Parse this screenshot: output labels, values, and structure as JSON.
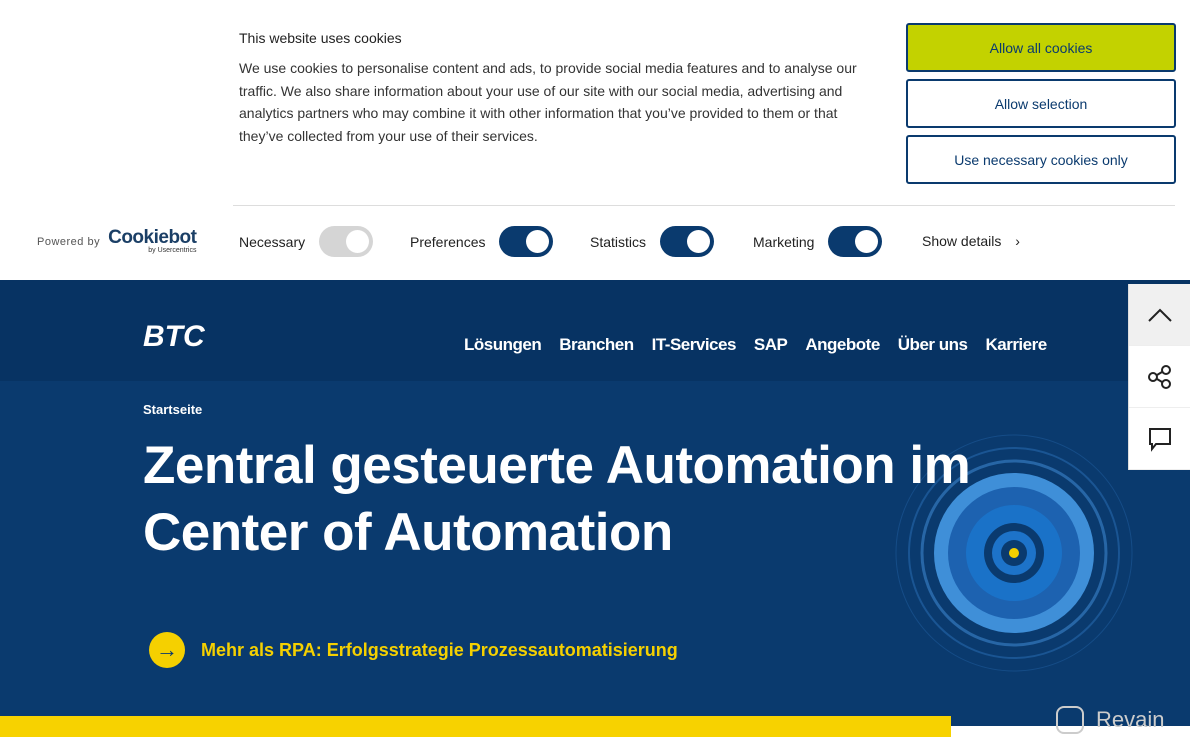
{
  "cookie": {
    "title": "This website uses cookies",
    "body": "We use cookies to personalise content and ads, to provide social media features and to analyse our traffic. We also share information about your use of our site with our social media, advertising and analytics partners who may combine it with other information that you’ve provided to them or that they’ve collected from your use of their services.",
    "allow_all": "Allow all cookies",
    "allow_selection": "Allow selection",
    "necessary_only": "Use necessary cookies only",
    "powered_by": "Powered by",
    "logo": "Cookiebot",
    "logo_sub": "by Usercentrics",
    "toggles": [
      {
        "label": "Necessary",
        "on": true,
        "disabled": true
      },
      {
        "label": "Preferences",
        "on": true
      },
      {
        "label": "Statistics",
        "on": true
      },
      {
        "label": "Marketing",
        "on": true
      }
    ],
    "show_details": "Show details"
  },
  "site": {
    "logo": "BTC",
    "nav": [
      "Lösungen",
      "Branchen",
      "IT-Services",
      "SAP",
      "Angebote",
      "Über uns",
      "Karriere"
    ],
    "breadcrumb": "Startseite",
    "title": "Zentral gesteuerte Automation im Center of Automation",
    "cta": "Mehr als RPA: Erfolgsstrategie Prozessautomatisierung"
  },
  "colors": {
    "navy": "#0a3a6e",
    "accent_green": "#c3d200",
    "yellow": "#f7d200"
  },
  "watermark": "Revain"
}
